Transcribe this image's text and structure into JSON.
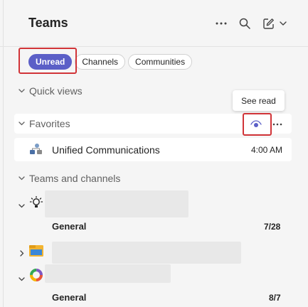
{
  "header": {
    "title": "Teams",
    "icons": [
      "more-options-icon",
      "search-icon",
      "compose-icon",
      "chevron-down-icon"
    ]
  },
  "filters": [
    {
      "label": "Unread",
      "active": true
    },
    {
      "label": "Channels",
      "active": false
    },
    {
      "label": "Communities",
      "active": false
    }
  ],
  "quick_views": {
    "label": "Quick views"
  },
  "favorites": {
    "label": "Favorites",
    "tooltip": "See read"
  },
  "favorite_chats": [
    {
      "name": "Unified Communications",
      "time": "4:00 AM"
    }
  ],
  "teams_and_channels": {
    "label": "Teams and channels"
  },
  "teams": [
    {
      "expanded": true,
      "icon": "lightbulb-icon",
      "channel": "General",
      "count": "7/28"
    },
    {
      "expanded": false,
      "icon": "folder-icon"
    },
    {
      "expanded": true,
      "icon": "ring-icon",
      "channel": "General",
      "count": "8/7"
    }
  ],
  "colors": {
    "accent": "#5b5fc7",
    "highlight": "#d13438"
  }
}
